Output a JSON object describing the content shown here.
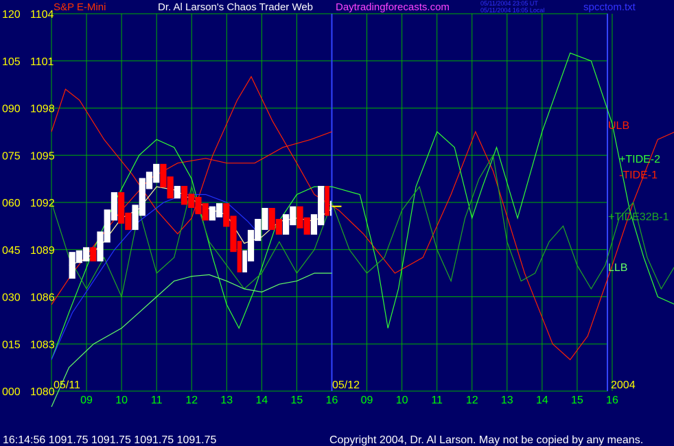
{
  "header": {
    "symbol_label": "S&P E-Mini",
    "title": "Dr. Al Larson's Chaos Trader Web",
    "website": "Daytradingforecasts.com",
    "timestamp_ut": "05/11/2004 23:05 UT",
    "timestamp_local": "05/11/2004 16:05 Local",
    "file_name": "spcctom.txt"
  },
  "footer": {
    "quote_line": "16:14:56  1091.75  1091.75  1091.75  1091.75",
    "copyright": "Copyright 2004, Dr. Al Larson. May not be copied by any means."
  },
  "colors": {
    "background": "#000066",
    "grid": "#00b000",
    "price_axis": "#ffff00",
    "date_axis": "#00ff00",
    "title": "#ffffff",
    "website": "#ff44ff",
    "info": "#3333ff",
    "up_bar": "#ffffff",
    "down_bar": "#ff0000",
    "close_marker": "#ffff00",
    "blue_curve": "#2233ff",
    "separator": "#3344ff"
  },
  "chart_data": {
    "type": "line",
    "title": "S&P E-Mini",
    "left_axis_ticks": [
      "000",
      "015",
      "030",
      "045",
      "060",
      "075",
      "090",
      "105",
      "120"
    ],
    "price_ticks": [
      "1080",
      "1083",
      "1086",
      "1089",
      "1092",
      "1095",
      "1098",
      "1101",
      "1104"
    ],
    "ylim_index": [
      0,
      120
    ],
    "ylim_price": [
      1080,
      1104
    ],
    "x_hour_labels": [
      "09",
      "10",
      "11",
      "12",
      "13",
      "14",
      "15",
      "16",
      "09",
      "10",
      "11",
      "12",
      "13",
      "14",
      "15",
      "16"
    ],
    "date_labels": [
      "05/11",
      "05/12",
      "2004"
    ],
    "grid": true,
    "price_bars": {
      "note": "intraday bars, 05/11 08:30-16:00, hour units",
      "points": [
        [
          8.5,
          1087.5
        ],
        [
          8.7,
          1088.5
        ],
        [
          8.9,
          1088.6
        ],
        [
          9.1,
          1088.8
        ],
        [
          9.3,
          1088.6
        ],
        [
          9.5,
          1089.8
        ],
        [
          9.7,
          1091.2
        ],
        [
          9.9,
          1092.3
        ],
        [
          10.1,
          1091.0
        ],
        [
          10.3,
          1090.6
        ],
        [
          10.5,
          1091.5
        ],
        [
          10.7,
          1093.2
        ],
        [
          10.9,
          1093.6
        ],
        [
          11.1,
          1094.1
        ],
        [
          11.3,
          1093.3
        ],
        [
          11.5,
          1092.6
        ],
        [
          11.7,
          1092.7
        ],
        [
          11.9,
          1092.2
        ],
        [
          12.1,
          1092.0
        ],
        [
          12.3,
          1091.6
        ],
        [
          12.5,
          1091.2
        ],
        [
          12.7,
          1091.4
        ],
        [
          12.9,
          1091.6
        ],
        [
          13.1,
          1090.8
        ],
        [
          13.3,
          1089.2
        ],
        [
          13.45,
          1087.9
        ],
        [
          13.6,
          1088.6
        ],
        [
          13.8,
          1089.9
        ],
        [
          14.0,
          1090.6
        ],
        [
          14.2,
          1091.3
        ],
        [
          14.4,
          1090.6
        ],
        [
          14.6,
          1090.3
        ],
        [
          14.8,
          1090.9
        ],
        [
          15.0,
          1091.4
        ],
        [
          15.2,
          1090.7
        ],
        [
          15.4,
          1090.3
        ],
        [
          15.6,
          1090.9
        ],
        [
          15.8,
          1092.7
        ],
        [
          15.95,
          1091.5
        ],
        [
          16.0,
          1091.75
        ]
      ]
    },
    "series": [
      {
        "name": "ULB",
        "color": "#ff2200",
        "points": [
          [
            8.0,
            1096.5
          ],
          [
            8.4,
            1099.2
          ],
          [
            8.8,
            1098.5
          ],
          [
            9.5,
            1096.0
          ],
          [
            10.3,
            1093.8
          ],
          [
            11.0,
            1091.5
          ],
          [
            11.6,
            1090.0
          ],
          [
            12.0,
            1091.0
          ],
          [
            12.6,
            1095.0
          ],
          [
            13.3,
            1098.5
          ],
          [
            13.7,
            1100.0
          ],
          [
            14.3,
            1097.2
          ],
          [
            15.0,
            1094.5
          ],
          [
            15.5,
            1092.5
          ],
          [
            16.2,
            1091.5
          ],
          [
            16.9,
            1090.0
          ],
          [
            17.8,
            1087.5
          ],
          [
            18.6,
            1088.5
          ],
          [
            19.4,
            1092.5
          ],
          [
            20.1,
            1096.5
          ],
          [
            20.6,
            1094.0
          ],
          [
            21.5,
            1087.5
          ],
          [
            22.3,
            1083.0
          ],
          [
            22.8,
            1082.0
          ],
          [
            23.3,
            1083.5
          ],
          [
            24.0,
            1088.0
          ],
          [
            24.6,
            1092.0
          ],
          [
            25.3,
            1096.0
          ],
          [
            25.8,
            1096.5
          ],
          [
            26.0,
            1094.0
          ]
        ]
      },
      {
        "name": "-TIDE-1",
        "color": "#ff2200",
        "points": [
          [
            8.0,
            1085.5
          ],
          [
            8.6,
            1087.5
          ],
          [
            9.3,
            1089.5
          ],
          [
            10.0,
            1091.5
          ],
          [
            10.8,
            1093.5
          ],
          [
            11.6,
            1094.5
          ],
          [
            12.4,
            1094.8
          ],
          [
            13.0,
            1094.5
          ],
          [
            13.8,
            1094.5
          ],
          [
            14.6,
            1095.5
          ],
          [
            15.4,
            1096.0
          ],
          [
            16.0,
            1096.5
          ]
        ]
      },
      {
        "name": "+TIDE-2",
        "color": "#33ff33",
        "points": [
          [
            8.0,
            1082.0
          ],
          [
            8.5,
            1085.0
          ],
          [
            9.2,
            1089.0
          ],
          [
            9.8,
            1092.0
          ],
          [
            10.5,
            1095.0
          ],
          [
            11.0,
            1096.0
          ],
          [
            11.5,
            1095.5
          ],
          [
            12.0,
            1093.5
          ],
          [
            12.6,
            1088.5
          ],
          [
            13.0,
            1085.5
          ],
          [
            13.35,
            1084.0
          ],
          [
            13.8,
            1086.5
          ],
          [
            14.4,
            1090.5
          ],
          [
            15.0,
            1092.5
          ],
          [
            15.5,
            1093.0
          ],
          [
            16.0,
            1093.0
          ],
          [
            16.8,
            1092.5
          ],
          [
            17.3,
            1088.0
          ],
          [
            17.6,
            1084.0
          ],
          [
            17.9,
            1086.5
          ],
          [
            18.4,
            1093.0
          ],
          [
            19.0,
            1096.5
          ],
          [
            19.5,
            1095.5
          ],
          [
            20.0,
            1091.0
          ],
          [
            20.3,
            1093.0
          ],
          [
            20.7,
            1095.5
          ],
          [
            21.3,
            1091.0
          ],
          [
            22.0,
            1096.5
          ],
          [
            22.8,
            1101.5
          ],
          [
            23.4,
            1101.0
          ],
          [
            24.0,
            1097.0
          ],
          [
            24.5,
            1091.5
          ],
          [
            24.9,
            1088.5
          ],
          [
            25.3,
            1086.0
          ],
          [
            25.8,
            1085.5
          ],
          [
            26.0,
            1094.5
          ]
        ]
      },
      {
        "name": "+TIDE32B-1",
        "color": "#22aa22",
        "points": [
          [
            8.0,
            1092.0
          ],
          [
            8.5,
            1088.5
          ],
          [
            9.0,
            1086.5
          ],
          [
            9.5,
            1088.5
          ],
          [
            10.0,
            1086.0
          ],
          [
            10.5,
            1091.5
          ],
          [
            11.0,
            1087.5
          ],
          [
            11.5,
            1088.5
          ],
          [
            12.0,
            1093.0
          ],
          [
            12.5,
            1089.5
          ],
          [
            13.0,
            1088.0
          ],
          [
            13.5,
            1086.5
          ],
          [
            14.0,
            1087.5
          ],
          [
            14.5,
            1089.5
          ],
          [
            15.0,
            1087.5
          ],
          [
            15.5,
            1089.0
          ],
          [
            16.0,
            1092.0
          ],
          [
            16.5,
            1089.0
          ],
          [
            17.0,
            1087.5
          ],
          [
            17.5,
            1088.5
          ],
          [
            18.0,
            1091.5
          ],
          [
            18.5,
            1093.0
          ],
          [
            19.0,
            1089.0
          ],
          [
            19.4,
            1087.0
          ],
          [
            19.8,
            1091.0
          ],
          [
            20.2,
            1093.5
          ],
          [
            20.6,
            1095.0
          ],
          [
            21.0,
            1089.5
          ],
          [
            21.4,
            1087.0
          ],
          [
            21.8,
            1087.5
          ],
          [
            22.2,
            1089.5
          ],
          [
            22.6,
            1090.5
          ],
          [
            23.0,
            1088.0
          ],
          [
            23.4,
            1086.5
          ],
          [
            23.8,
            1088.0
          ],
          [
            24.2,
            1091.0
          ],
          [
            24.6,
            1092.0
          ],
          [
            25.0,
            1088.5
          ],
          [
            25.4,
            1086.5
          ],
          [
            25.8,
            1088.0
          ],
          [
            26.0,
            1092.0
          ]
        ]
      },
      {
        "name": "LLB",
        "color": "#66ff66",
        "points": [
          [
            8.0,
            1079.0
          ],
          [
            8.5,
            1081.5
          ],
          [
            9.2,
            1083.0
          ],
          [
            10.0,
            1084.0
          ],
          [
            10.5,
            1085.0
          ],
          [
            11.0,
            1086.0
          ],
          [
            11.5,
            1087.0
          ],
          [
            12.0,
            1087.3
          ],
          [
            12.5,
            1087.4
          ],
          [
            13.0,
            1087.0
          ],
          [
            13.5,
            1086.5
          ],
          [
            14.0,
            1086.3
          ],
          [
            14.5,
            1086.8
          ],
          [
            15.0,
            1087.0
          ],
          [
            15.5,
            1087.5
          ],
          [
            16.0,
            1087.5
          ]
        ]
      },
      {
        "name": "",
        "color": "#2233ff",
        "points": [
          [
            8.0,
            1082.0
          ],
          [
            8.6,
            1085.0
          ],
          [
            9.2,
            1087.0
          ],
          [
            9.8,
            1089.0
          ],
          [
            10.5,
            1090.8
          ],
          [
            11.2,
            1092.0
          ],
          [
            11.8,
            1092.5
          ],
          [
            12.4,
            1092.5
          ],
          [
            13.0,
            1092.0
          ],
          [
            13.6,
            1090.8
          ],
          [
            14.0,
            1089.8
          ]
        ]
      },
      {
        "name": "",
        "color": "#ffff99",
        "points": [
          [
            8.5,
            1088.0
          ],
          [
            9.0,
            1088.4
          ],
          [
            9.5,
            1089.5
          ],
          [
            10.0,
            1091.0
          ],
          [
            10.5,
            1091.6
          ],
          [
            11.0,
            1093.0
          ],
          [
            11.5,
            1092.8
          ],
          [
            12.0,
            1092.2
          ],
          [
            12.5,
            1091.6
          ],
          [
            13.0,
            1091.2
          ],
          [
            13.5,
            1089.4
          ],
          [
            14.0,
            1089.8
          ],
          [
            14.5,
            1090.8
          ],
          [
            15.0,
            1091.0
          ],
          [
            15.5,
            1090.8
          ],
          [
            16.0,
            1091.6
          ]
        ]
      }
    ]
  }
}
